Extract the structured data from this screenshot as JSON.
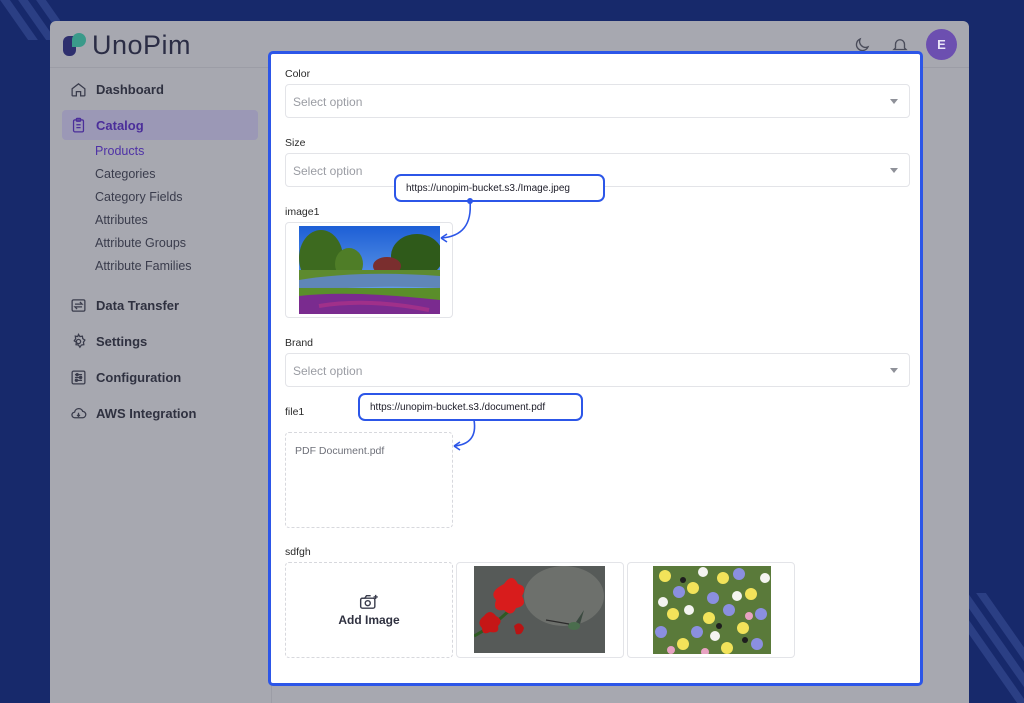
{
  "brand": {
    "name": "UnoPim"
  },
  "topbar": {
    "avatar_initial": "E",
    "icons": [
      "moon-icon",
      "bell-icon"
    ]
  },
  "sidebar": {
    "items": [
      {
        "label": "Dashboard",
        "icon": "home-icon"
      },
      {
        "label": "Catalog",
        "icon": "clipboard-icon",
        "active": true
      },
      {
        "label": "Data Transfer",
        "icon": "transfer-icon"
      },
      {
        "label": "Settings",
        "icon": "gear-icon"
      },
      {
        "label": "Configuration",
        "icon": "sliders-icon"
      },
      {
        "label": "AWS Integration",
        "icon": "cloud-icon"
      }
    ],
    "catalog_sub": [
      "Products",
      "Categories",
      "Category Fields",
      "Attributes",
      "Attribute Groups",
      "Attribute Families"
    ]
  },
  "form": {
    "color": {
      "label": "Color",
      "placeholder": "Select option"
    },
    "size": {
      "label": "Size",
      "placeholder": "Select option"
    },
    "image1": {
      "label": "image1"
    },
    "brand": {
      "label": "Brand",
      "placeholder": "Select option"
    },
    "file1": {
      "label": "file1",
      "file_name": "PDF Document.pdf"
    },
    "gallery": {
      "label": "sdfgh",
      "add_label": "Add Image"
    }
  },
  "callouts": {
    "image_url": "https://unopim-bucket.s3./Image.jpeg",
    "file_url": "https://unopim-bucket.s3./document.pdf"
  },
  "colors": {
    "accent": "#2c56e8",
    "background": "#17296b",
    "active": "#4f32a6"
  }
}
